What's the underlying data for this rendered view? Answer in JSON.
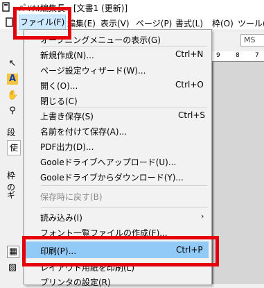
{
  "window": {
    "title_text": "ﾊﾟｿﾅﾙ編集長 - [文書1 (更新)]"
  },
  "menubar": {
    "items": [
      {
        "label": "ファイル(F)"
      },
      {
        "label": "編集(E)"
      },
      {
        "label": "表示(V)"
      },
      {
        "label": "ページ(P)"
      },
      {
        "label": "書式(L)"
      },
      {
        "label": "枠(O)"
      },
      {
        "label": "ツール("
      }
    ]
  },
  "toolbar": {
    "font_name": "MS",
    "ruler_marks": [
      "9",
      "8",
      "7"
    ]
  },
  "sidebar": {
    "label_1": "段",
    "box_1": "使",
    "label_2": "枠の",
    "label_3": "ギ"
  },
  "file_menu": {
    "items": [
      {
        "label": "オープニングメニューの表示(G)",
        "shortcut": ""
      },
      {
        "label": "新規作成(N)...",
        "shortcut": "Ctrl+N"
      },
      {
        "label": "ページ設定ウィザード(W)...",
        "shortcut": ""
      },
      {
        "label": "開く(O)...",
        "shortcut": "Ctrl+O"
      },
      {
        "label": "閉じる(C)",
        "shortcut": ""
      },
      {
        "label": "上書き保存(S)",
        "shortcut": "Ctrl+S"
      },
      {
        "label": "名前を付けて保存(A)...",
        "shortcut": ""
      },
      {
        "label": "PDF出力(D)...",
        "shortcut": ""
      },
      {
        "label": "Gooleドライブへアップロード(U)...",
        "shortcut": ""
      },
      {
        "label": "Gooleドライブからダウンロード(Y)...",
        "shortcut": ""
      },
      {
        "label": "保存時に戻す(B)",
        "shortcut": "",
        "disabled": true
      },
      {
        "label": "読み込み(I)",
        "shortcut": ""
      },
      {
        "label": "フォント一覧ファイルの作成(F)...",
        "shortcut": ""
      },
      {
        "label": "印刷(P)...",
        "shortcut": "Ctrl+P",
        "highlighted": true
      },
      {
        "label": "レイアウト用紙を印刷(L)",
        "shortcut": ""
      },
      {
        "label": "プリンタの設定(R)",
        "shortcut": ""
      }
    ]
  },
  "colors": {
    "annotation": "#e5000a",
    "highlight": "#91c9f7"
  }
}
